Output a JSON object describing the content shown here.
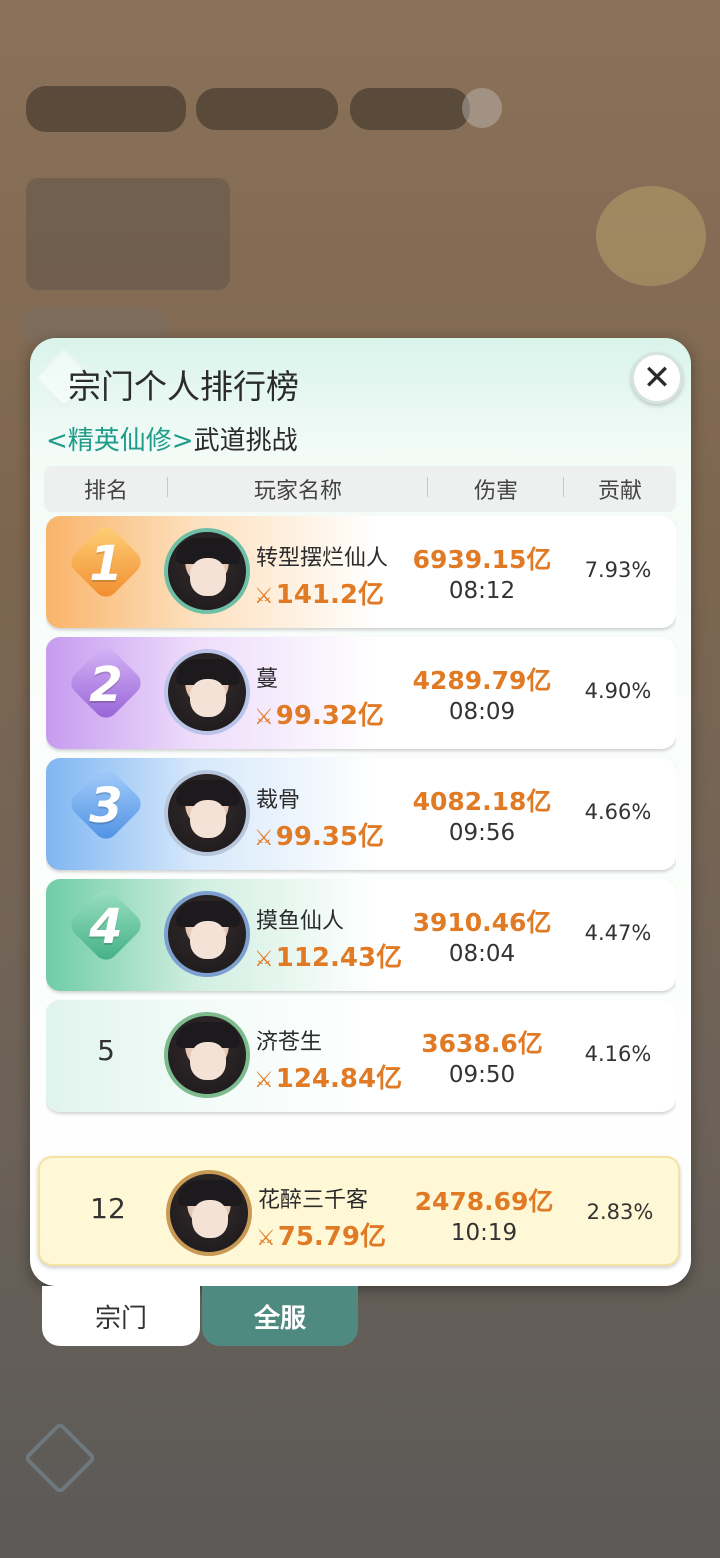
{
  "panel": {
    "title": "宗门个人排行榜",
    "subtitle_tag": "<精英仙修>",
    "subtitle_rest": "武道挑战",
    "close_icon": "close-icon"
  },
  "table": {
    "headers": [
      "排名",
      "玩家名称",
      "伤害",
      "贡献"
    ],
    "rows": [
      {
        "rank": "1",
        "name": "转型摆烂仙人",
        "power": "141.2亿",
        "damage": "6939.15亿",
        "time": "08:12",
        "contribution": "7.93%"
      },
      {
        "rank": "2",
        "name": "蔓",
        "power": "99.32亿",
        "damage": "4289.79亿",
        "time": "08:09",
        "contribution": "4.90%"
      },
      {
        "rank": "3",
        "name": "裁骨",
        "power": "99.35亿",
        "damage": "4082.18亿",
        "time": "09:56",
        "contribution": "4.66%"
      },
      {
        "rank": "4",
        "name": "摸鱼仙人",
        "power": "112.43亿",
        "damage": "3910.46亿",
        "time": "08:04",
        "contribution": "4.47%"
      },
      {
        "rank": "5",
        "name": "济苍生",
        "power": "124.84亿",
        "damage": "3638.6亿",
        "time": "09:50",
        "contribution": "4.16%"
      }
    ]
  },
  "my_rank": {
    "rank": "12",
    "name": "花醉三千客",
    "power": "75.79亿",
    "damage": "2478.69亿",
    "time": "10:19",
    "contribution": "2.83%"
  },
  "tabs": {
    "sect": "宗门",
    "all_server": "全服"
  },
  "colors": {
    "rank1": "#f6a24a",
    "rank2": "#b083e0",
    "rank3": "#6aa8ee",
    "rank4": "#5fc6a0",
    "damage": "#e07a25",
    "tag": "#1f9c8a"
  }
}
